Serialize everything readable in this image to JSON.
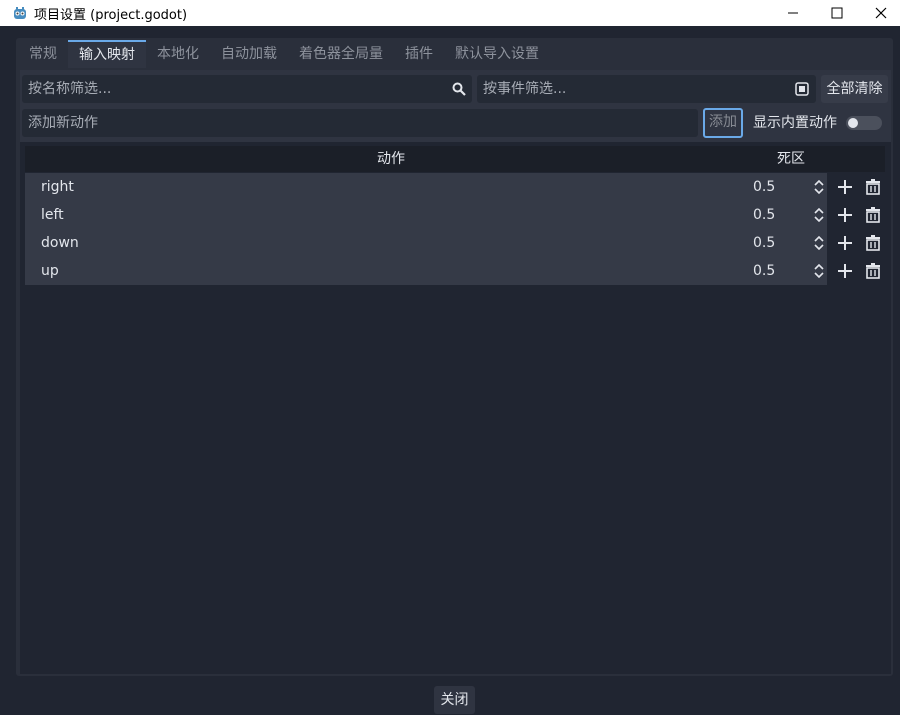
{
  "window": {
    "title": "项目设置 (project.godot)",
    "icon": "godot-icon"
  },
  "tabs": [
    {
      "label": "常规"
    },
    {
      "label": "输入映射",
      "active": true
    },
    {
      "label": "本地化"
    },
    {
      "label": "自动加载"
    },
    {
      "label": "着色器全局量"
    },
    {
      "label": "插件"
    },
    {
      "label": "默认导入设置"
    }
  ],
  "filters": {
    "name_placeholder": "按名称筛选...",
    "event_placeholder": "按事件筛选...",
    "clear_all_label": "全部清除"
  },
  "add_action": {
    "placeholder": "添加新动作",
    "add_label": "添加",
    "show_builtin_label": "显示内置动作",
    "show_builtin_enabled": false
  },
  "table": {
    "header_action": "动作",
    "header_deadzone": "死区",
    "rows": [
      {
        "name": "right",
        "deadzone": "0.5"
      },
      {
        "name": "left",
        "deadzone": "0.5"
      },
      {
        "name": "down",
        "deadzone": "0.5"
      },
      {
        "name": "up",
        "deadzone": "0.5"
      }
    ]
  },
  "footer": {
    "close_label": "关闭"
  },
  "colors": {
    "accent": "#6aa9e8",
    "background": "#202531",
    "panel": "#2f3441"
  }
}
